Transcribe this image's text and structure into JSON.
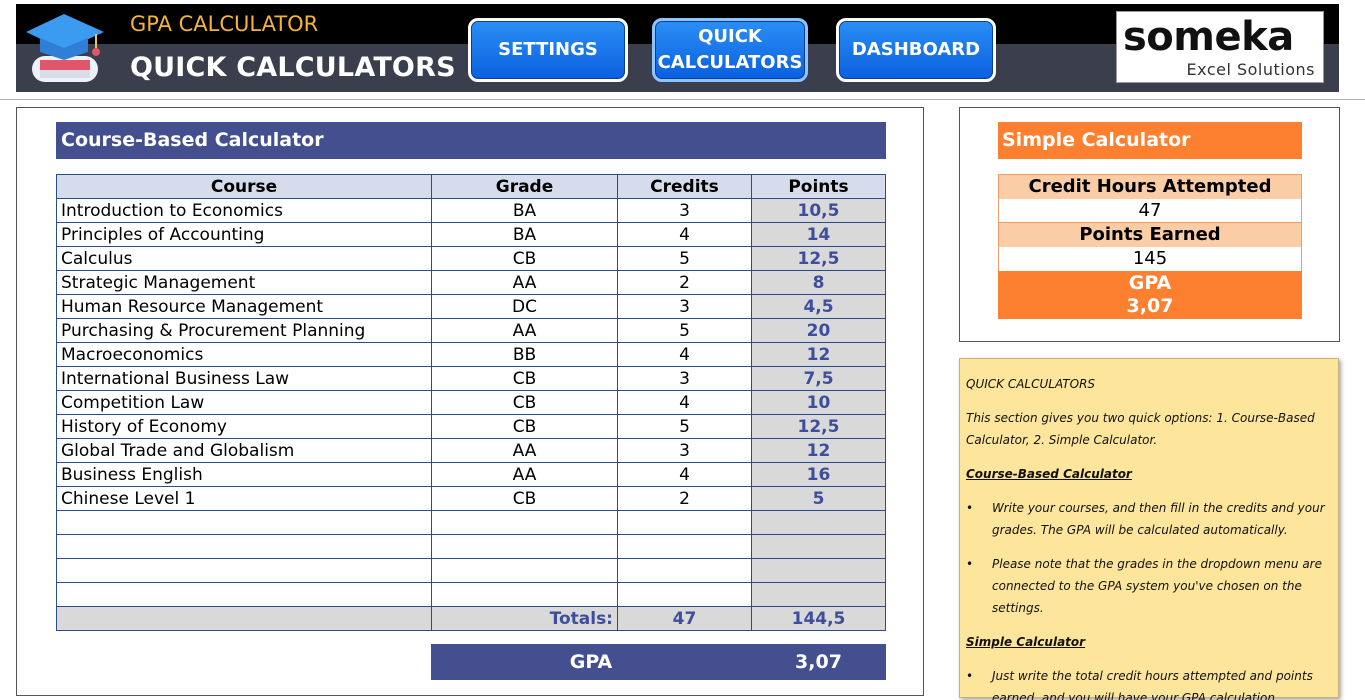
{
  "header": {
    "app_name": "GPA CALCULATOR",
    "page_name": "QUICK CALCULATORS",
    "nav": {
      "settings": "SETTINGS",
      "quick_line1": "QUICK",
      "quick_line2": "CALCULATORS",
      "dashboard": "DASHBOARD"
    },
    "brand": {
      "name": "someka",
      "sub": "Excel Solutions"
    }
  },
  "course_calc": {
    "title": "Course-Based Calculator",
    "columns": [
      "Course",
      "Grade",
      "Credits",
      "Points"
    ],
    "rows": [
      {
        "course": "Introduction to Economics",
        "grade": "BA",
        "credits": "3",
        "points": "10,5"
      },
      {
        "course": "Principles of Accounting",
        "grade": "BA",
        "credits": "4",
        "points": "14"
      },
      {
        "course": "Calculus",
        "grade": "CB",
        "credits": "5",
        "points": "12,5"
      },
      {
        "course": "Strategic Management",
        "grade": "AA",
        "credits": "2",
        "points": "8"
      },
      {
        "course": "Human Resource Management",
        "grade": "DC",
        "credits": "3",
        "points": "4,5"
      },
      {
        "course": "Purchasing & Procurement Planning",
        "grade": "AA",
        "credits": "5",
        "points": "20"
      },
      {
        "course": "Macroeconomics",
        "grade": "BB",
        "credits": "4",
        "points": "12"
      },
      {
        "course": "International Business Law",
        "grade": "CB",
        "credits": "3",
        "points": "7,5"
      },
      {
        "course": "Competition Law",
        "grade": "CB",
        "credits": "4",
        "points": "10"
      },
      {
        "course": "History of Economy",
        "grade": "CB",
        "credits": "5",
        "points": "12,5"
      },
      {
        "course": "Global Trade and Globalism",
        "grade": "AA",
        "credits": "3",
        "points": "12"
      },
      {
        "course": "Business English",
        "grade": "AA",
        "credits": "4",
        "points": "16"
      },
      {
        "course": "Chinese Level 1",
        "grade": "CB",
        "credits": "2",
        "points": "5"
      },
      {
        "course": "",
        "grade": "",
        "credits": "",
        "points": ""
      },
      {
        "course": "",
        "grade": "",
        "credits": "",
        "points": ""
      },
      {
        "course": "",
        "grade": "",
        "credits": "",
        "points": ""
      },
      {
        "course": "",
        "grade": "",
        "credits": "",
        "points": ""
      }
    ],
    "totals": {
      "label": "Totals:",
      "credits": "47",
      "points": "144,5"
    },
    "gpa_label": "GPA",
    "gpa_value": "3,07"
  },
  "simple_calc": {
    "title": "Simple Calculator",
    "credit_label": "Credit Hours Attempted",
    "credit_value": "47",
    "points_label": "Points Earned",
    "points_value": "145",
    "gpa_label": "GPA",
    "gpa_value": "3,07"
  },
  "note": {
    "title": "QUICK CALCULATORS",
    "intro": "This section gives you two quick options: 1. Course-Based Calculator, 2. Simple Calculator.",
    "course_head": "Course-Based Calculator",
    "course_b1": "Write your courses, and then fill in the credits and your grades. The GPA will be calculated automatically.",
    "course_b2": "Please note that the grades in the dropdown menu are connected to the GPA system you've chosen on the settings.",
    "simple_head": "Simple Calculator",
    "simple_b1": "Just write the total credit hours attempted and points earned, and you will have your GPA calculation."
  },
  "colors": {
    "accent_blue": "#434f8f",
    "accent_orange": "#fd8030",
    "nav_blue": "#0a5fe0",
    "note_yellow": "#fde59b"
  }
}
